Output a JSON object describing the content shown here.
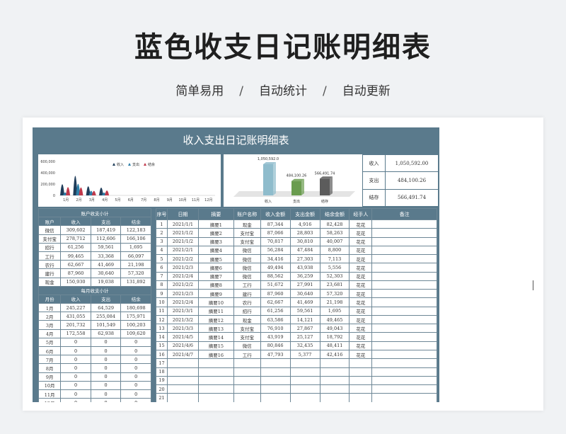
{
  "header": {
    "title": "蓝色收支日记账明细表",
    "tags": [
      "简单易用",
      "自动统计",
      "自动更新"
    ]
  },
  "sheet": {
    "title": "收入支出日记账明细表",
    "summary": [
      {
        "label": "收入",
        "value": "1,050,592.00"
      },
      {
        "label": "支出",
        "value": "484,100.26"
      },
      {
        "label": "结存",
        "value": "566,491.74"
      }
    ],
    "account_section_title": "账户收支小计",
    "account_headers": [
      "账户",
      "收入",
      "支出",
      "结余"
    ],
    "accounts": [
      [
        "微信",
        "309,602",
        "187,419",
        "122,183"
      ],
      [
        "支付宝",
        "278,712",
        "112,606",
        "166,106"
      ],
      [
        "招行",
        "61,256",
        "59,561",
        "1,695"
      ],
      [
        "工行",
        "99,465",
        "33,368",
        "66,097"
      ],
      [
        "农行",
        "62,667",
        "41,469",
        "21,198"
      ],
      [
        "建行",
        "87,960",
        "30,640",
        "57,320"
      ],
      [
        "现金",
        "150,930",
        "19,038",
        "131,892"
      ]
    ],
    "monthly_section_title": "每月收支小计",
    "monthly_headers": [
      "月份",
      "收入",
      "支出",
      "结余"
    ],
    "monthly": [
      [
        "1月",
        "245,227",
        "64,529",
        "180,698"
      ],
      [
        "2月",
        "431,055",
        "255,084",
        "175,971"
      ],
      [
        "3月",
        "201,732",
        "101,549",
        "100,203"
      ],
      [
        "4月",
        "172,558",
        "62,938",
        "109,620"
      ],
      [
        "5月",
        "0",
        "0",
        "0"
      ],
      [
        "6月",
        "0",
        "0",
        "0"
      ],
      [
        "7月",
        "0",
        "0",
        "0"
      ],
      [
        "8月",
        "0",
        "0",
        "0"
      ],
      [
        "9月",
        "0",
        "0",
        "0"
      ],
      [
        "10月",
        "0",
        "0",
        "0"
      ],
      [
        "11月",
        "0",
        "0",
        "0"
      ],
      [
        "12月",
        "0",
        "0",
        "0"
      ]
    ],
    "ledger_headers": [
      "序号",
      "日期",
      "摘要",
      "账户名称",
      "收入金额",
      "支出金额",
      "结余金额",
      "经手人",
      "备注"
    ],
    "ledger": [
      [
        "1",
        "2021/1/1",
        "摘要1",
        "现金",
        "87,344",
        "4,916",
        "82,428",
        "花花",
        ""
      ],
      [
        "2",
        "2021/1/2",
        "摘要2",
        "支付宝",
        "87,066",
        "28,803",
        "58,263",
        "花花",
        ""
      ],
      [
        "3",
        "2021/1/2",
        "摘要3",
        "支付宝",
        "70,817",
        "30,810",
        "40,007",
        "花花",
        ""
      ],
      [
        "4",
        "2021/2/1",
        "摘要4",
        "微信",
        "56,284",
        "47,484",
        "8,800",
        "花花",
        ""
      ],
      [
        "5",
        "2021/2/2",
        "摘要5",
        "微信",
        "34,416",
        "27,303",
        "7,113",
        "花花",
        ""
      ],
      [
        "6",
        "2021/2/3",
        "摘要6",
        "微信",
        "49,494",
        "43,938",
        "5,556",
        "花花",
        ""
      ],
      [
        "7",
        "2021/2/4",
        "摘要7",
        "微信",
        "88,562",
        "36,259",
        "52,303",
        "花花",
        ""
      ],
      [
        "8",
        "2021/2/2",
        "摘要8",
        "工行",
        "51,672",
        "27,991",
        "23,681",
        "花花",
        ""
      ],
      [
        "9",
        "2021/2/3",
        "摘要9",
        "建行",
        "87,960",
        "30,640",
        "57,320",
        "花花",
        ""
      ],
      [
        "10",
        "2021/2/4",
        "摘要10",
        "农行",
        "62,667",
        "41,469",
        "21,198",
        "花花",
        ""
      ],
      [
        "11",
        "2021/3/1",
        "摘要11",
        "招行",
        "61,256",
        "59,561",
        "1,695",
        "花花",
        ""
      ],
      [
        "12",
        "2021/3/2",
        "摘要12",
        "现金",
        "63,586",
        "14,121",
        "49,465",
        "花花",
        ""
      ],
      [
        "13",
        "2021/3/3",
        "摘要13",
        "支付宝",
        "76,910",
        "27,867",
        "49,043",
        "花花",
        ""
      ],
      [
        "14",
        "2021/4/5",
        "摘要14",
        "支付宝",
        "43,919",
        "25,127",
        "18,792",
        "花花",
        ""
      ],
      [
        "15",
        "2021/4/6",
        "摘要15",
        "微信",
        "80,846",
        "32,435",
        "48,411",
        "花花",
        ""
      ],
      [
        "16",
        "2021/4/7",
        "摘要16",
        "工行",
        "47,793",
        "5,377",
        "42,416",
        "花花",
        ""
      ],
      [
        "17",
        "",
        "",
        "",
        "",
        "",
        "",
        "",
        ""
      ],
      [
        "18",
        "",
        "",
        "",
        "",
        "",
        "",
        "",
        ""
      ],
      [
        "19",
        "",
        "",
        "",
        "",
        "",
        "",
        "",
        ""
      ],
      [
        "20",
        "",
        "",
        "",
        "",
        "",
        "",
        "",
        ""
      ],
      [
        "21",
        "",
        "",
        "",
        "",
        "",
        "",
        "",
        ""
      ]
    ]
  },
  "chart_data": [
    {
      "type": "area",
      "title": "",
      "categories": [
        "1月",
        "2月",
        "3月",
        "4月",
        "5月",
        "6月",
        "7月",
        "8月",
        "9月",
        "10月",
        "11月",
        "12月"
      ],
      "ylim": [
        0,
        600000
      ],
      "yticks": [
        "600,000",
        "400,000",
        "200,000",
        "0"
      ],
      "series": [
        {
          "name": "收入",
          "color": "#1f3d5a",
          "values": [
            245227,
            431055,
            201732,
            172558,
            0,
            0,
            0,
            0,
            0,
            0,
            0,
            0
          ]
        },
        {
          "name": "支出",
          "color": "#2e7fa8",
          "values": [
            64529,
            255084,
            101549,
            62938,
            0,
            0,
            0,
            0,
            0,
            0,
            0,
            0
          ]
        },
        {
          "name": "结余",
          "color": "#c0394b",
          "values": [
            180698,
            175971,
            100203,
            109620,
            0,
            0,
            0,
            0,
            0,
            0,
            0,
            0
          ]
        }
      ]
    },
    {
      "type": "bar",
      "title": "",
      "categories": [
        "收入",
        "支出",
        "结存"
      ],
      "values": [
        1050592.0,
        484100.26,
        566491.74
      ],
      "value_labels": [
        "1,050,592.0",
        "484,100.26",
        "566,491.74"
      ],
      "colors": [
        "#8fbccc",
        "#6a9c4f",
        "#5c5c5c"
      ]
    }
  ]
}
